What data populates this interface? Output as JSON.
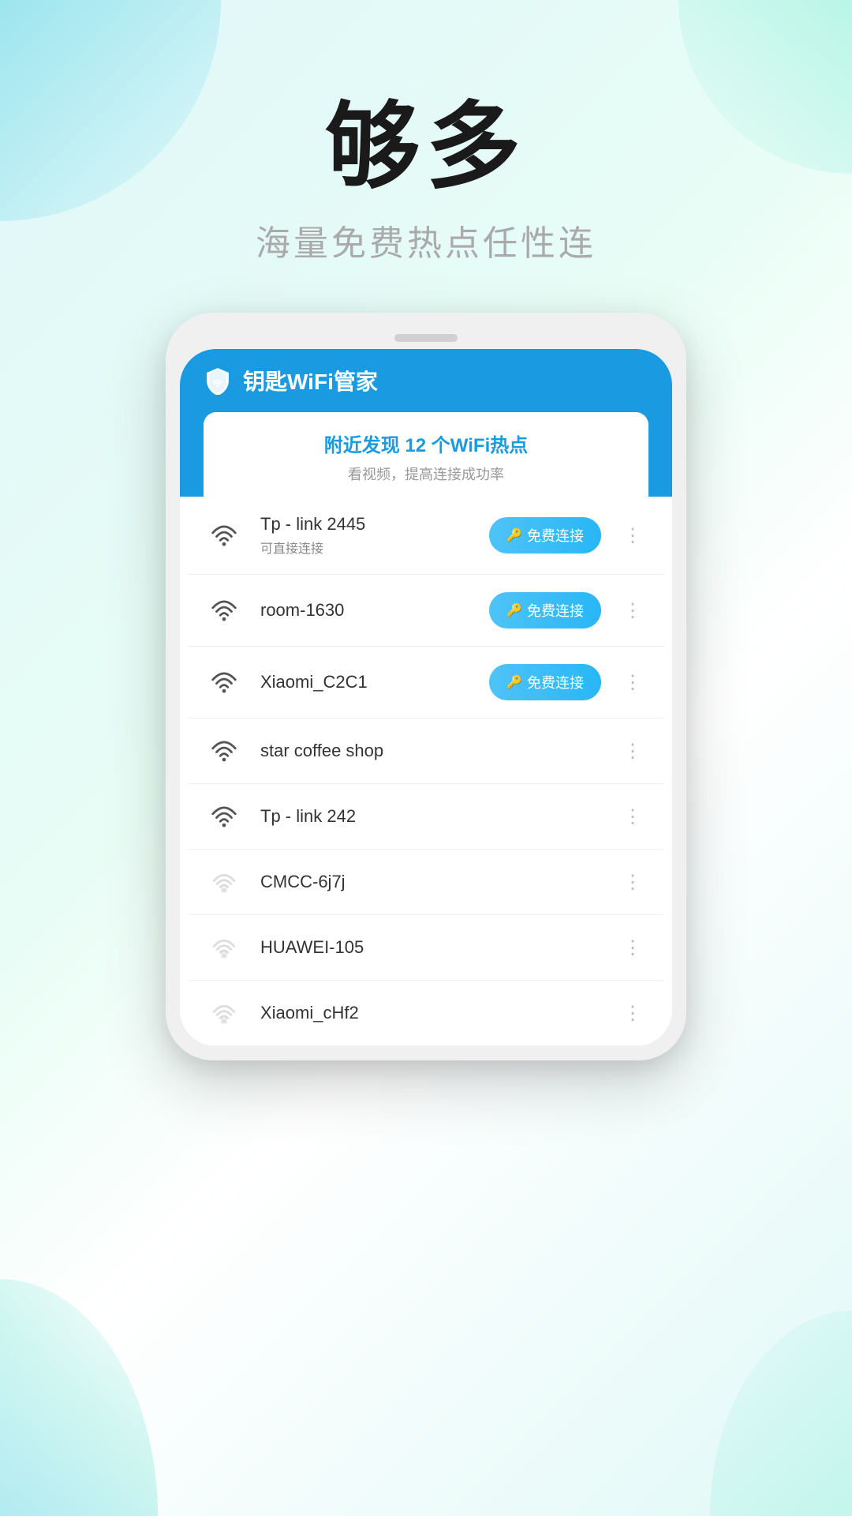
{
  "headline": "够多",
  "subheadline": "海量免费热点任性连",
  "app": {
    "title": "钥匙WiFi管家",
    "discovery_title": "附近发现 12 个WiFi热点",
    "discovery_sub": "看视频，提高连接成功率"
  },
  "wifi_list": [
    {
      "name": "Tp - link 2445",
      "sub": "可直接连接",
      "locked": false,
      "connect_btn": "免费连接",
      "show_btn": true
    },
    {
      "name": "room-1630",
      "sub": "",
      "locked": false,
      "connect_btn": "免费连接",
      "show_btn": true
    },
    {
      "name": "Xiaomi_C2C1",
      "sub": "",
      "locked": false,
      "connect_btn": "免费连接",
      "show_btn": true
    },
    {
      "name": "star coffee shop",
      "sub": "",
      "locked": false,
      "connect_btn": "",
      "show_btn": false
    },
    {
      "name": "Tp - link 242",
      "sub": "",
      "locked": false,
      "connect_btn": "",
      "show_btn": false
    },
    {
      "name": "CMCC-6j7j",
      "sub": "",
      "locked": true,
      "connect_btn": "",
      "show_btn": false
    },
    {
      "name": "HUAWEI-105",
      "sub": "",
      "locked": true,
      "connect_btn": "",
      "show_btn": false
    },
    {
      "name": "Xiaomi_cHf2",
      "sub": "",
      "locked": true,
      "connect_btn": "",
      "show_btn": false
    }
  ],
  "labels": {
    "free_connect": "免费连接",
    "more_dots": "⋮"
  }
}
